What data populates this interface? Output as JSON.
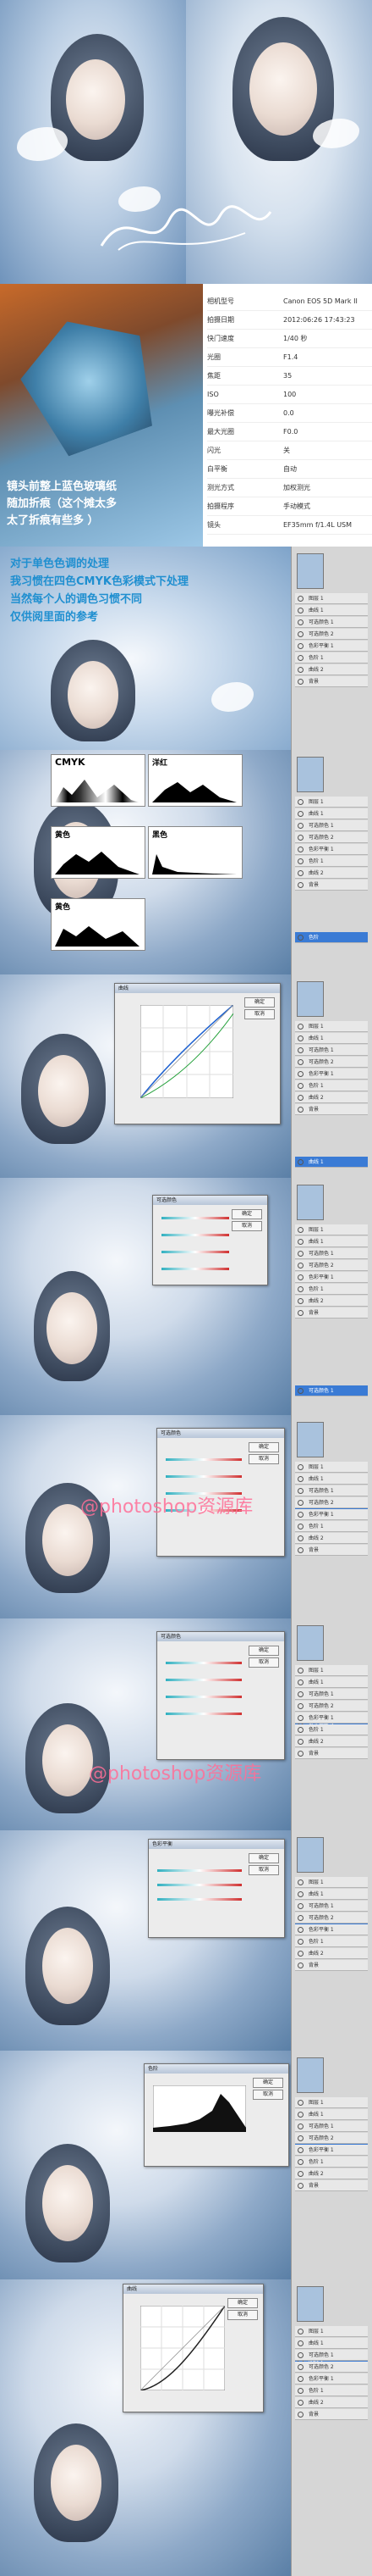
{
  "exif": {
    "rows": [
      {
        "label": "相机型号",
        "value": "Canon EOS 5D Mark II"
      },
      {
        "label": "拍摄日期",
        "value": "2012:06:26 17:43:23"
      },
      {
        "label": "快门速度",
        "value": "1/40 秒"
      },
      {
        "label": "光圈",
        "value": "F1.4"
      },
      {
        "label": "焦距",
        "value": "35"
      },
      {
        "label": "ISO",
        "value": "100"
      },
      {
        "label": "曝光补偿",
        "value": "0.0"
      },
      {
        "label": "最大光圈",
        "value": "F0.0"
      },
      {
        "label": "闪光",
        "value": "关"
      },
      {
        "label": "白平衡",
        "value": "自动"
      },
      {
        "label": "测光方式",
        "value": "加权测光"
      },
      {
        "label": "拍摄程序",
        "value": "手动模式"
      },
      {
        "label": "镜头",
        "value": "EF35mm f/1.4L USM"
      }
    ]
  },
  "captions": {
    "glass_line1": "镜头前整上蓝色玻璃纸",
    "glass_line2": "随加折痕（这个摊太多",
    "glass_line3": "太了折痕有些多          ）",
    "process_line1": "对于单色色调的处理",
    "process_line2": "我习惯在四色CMYK色彩模式下处理",
    "process_line3": "当然每个人的调色习惯不同",
    "process_line4": "仅供阅里面的参考"
  },
  "channels": {
    "cmyk": "CMYK",
    "cyan": "洋红",
    "yellow": "黄色",
    "black": "黑色",
    "yellow2": "黄色"
  },
  "watermark": "@photoshop资源库",
  "signature": "签名",
  "dialogs": {
    "curves_title": "曲线",
    "ok": "确定",
    "cancel": "取消",
    "selective_title": "可选颜色",
    "levels_title": "色阶"
  },
  "layers": [
    "图层 1",
    "曲线 1",
    "可选颜色 1",
    "可选颜色 2",
    "色彩平衡 1",
    "色阶 1",
    "曲线 2",
    "背景"
  ]
}
